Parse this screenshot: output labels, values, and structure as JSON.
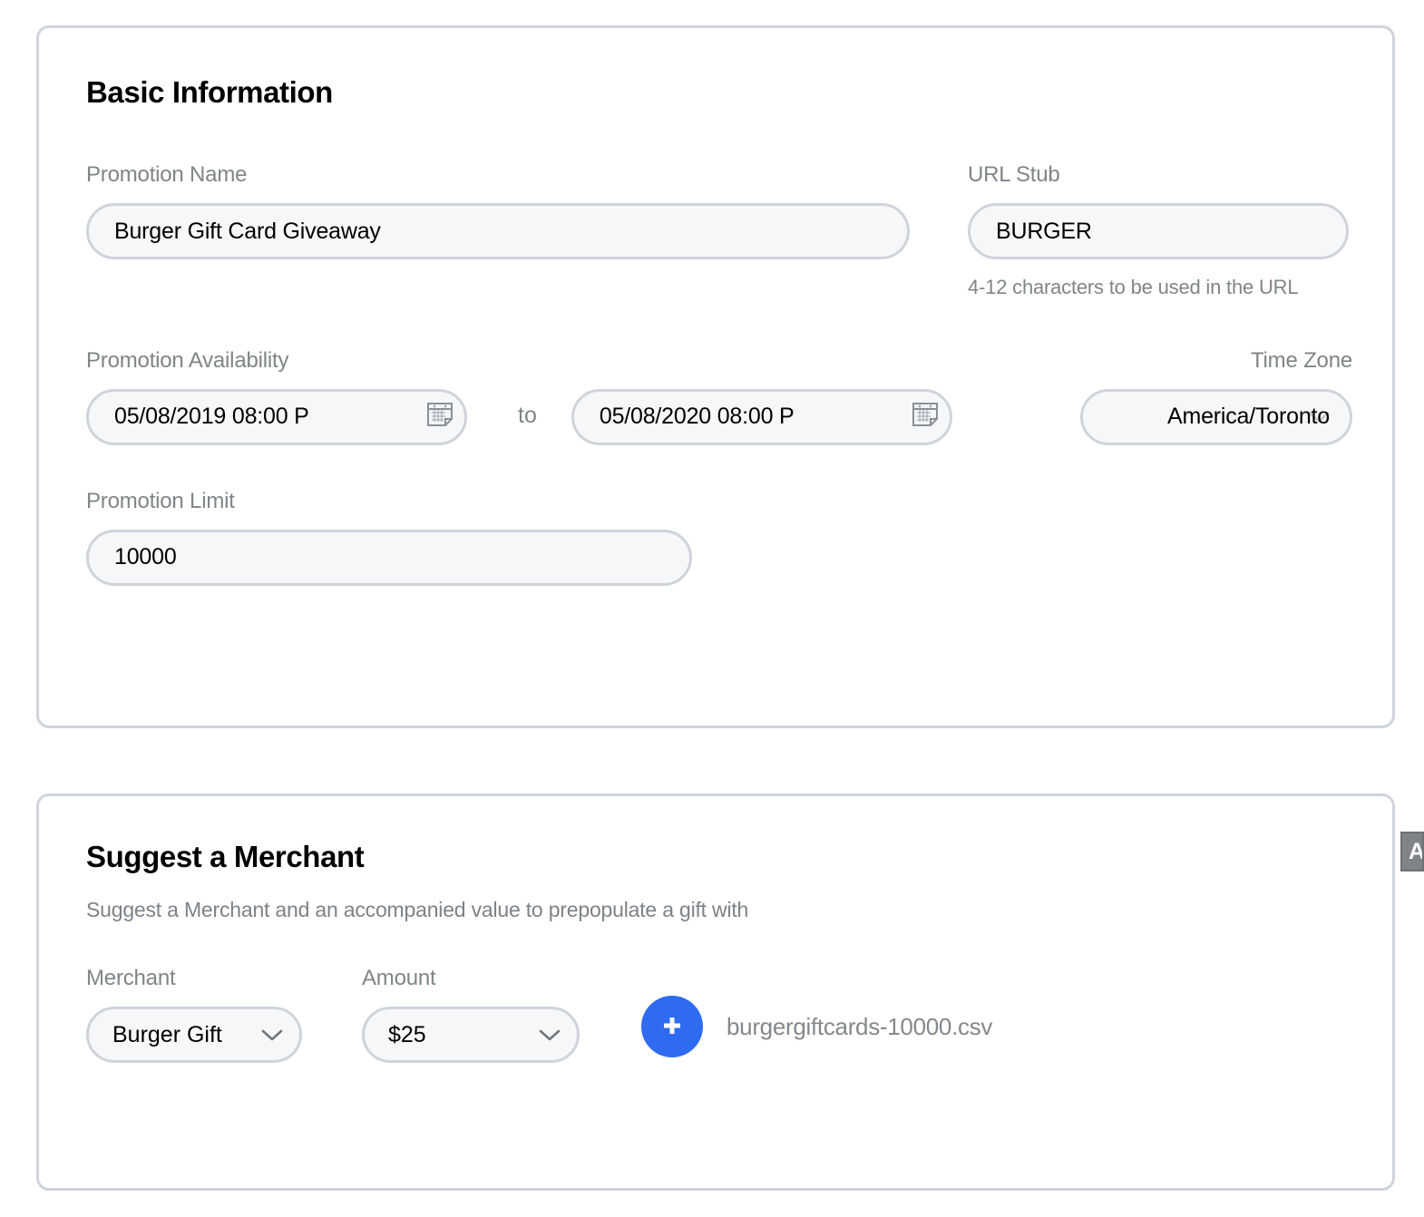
{
  "basic_information": {
    "title": "Basic Information",
    "promotion_name": {
      "label": "Promotion Name",
      "value": "Burger Gift Card Giveaway"
    },
    "url_stub": {
      "label": "URL Stub",
      "value": "BURGER",
      "helper": "4-12 characters to be used in the URL"
    },
    "promotion_availability": {
      "label": "Promotion Availability",
      "start_value": "05/08/2019 08:00 P",
      "end_value": "05/08/2020 08:00 P",
      "separator": "to",
      "calendar_icon": "calendar-icon"
    },
    "time_zone": {
      "label": "Time Zone",
      "value": "America/Toronto",
      "chevron_icon": "chevron-down-icon"
    },
    "promotion_limit": {
      "label": "Promotion Limit",
      "value": "10000"
    }
  },
  "suggest_merchant": {
    "title": "Suggest a Merchant",
    "subtitle": "Suggest a Merchant and an accompanied value to prepopulate a gift with",
    "merchant": {
      "label": "Merchant",
      "value": "Burger Gift",
      "chevron_icon": "chevron-down-icon"
    },
    "amount": {
      "label": "Amount",
      "value": "$25",
      "chevron_icon": "chevron-down-icon"
    },
    "upload": {
      "button_icon": "plus-icon",
      "button_label": "+",
      "file_name": "burgergiftcards-10000.csv"
    }
  },
  "edge_tab": {
    "label": "A"
  },
  "colors": {
    "accent_blue": "#2f6bf0",
    "border_gray": "#ced4da",
    "input_fill": "#f6f7f9",
    "label_gray": "#7f8588",
    "edge_tab_gray": "#808488"
  }
}
